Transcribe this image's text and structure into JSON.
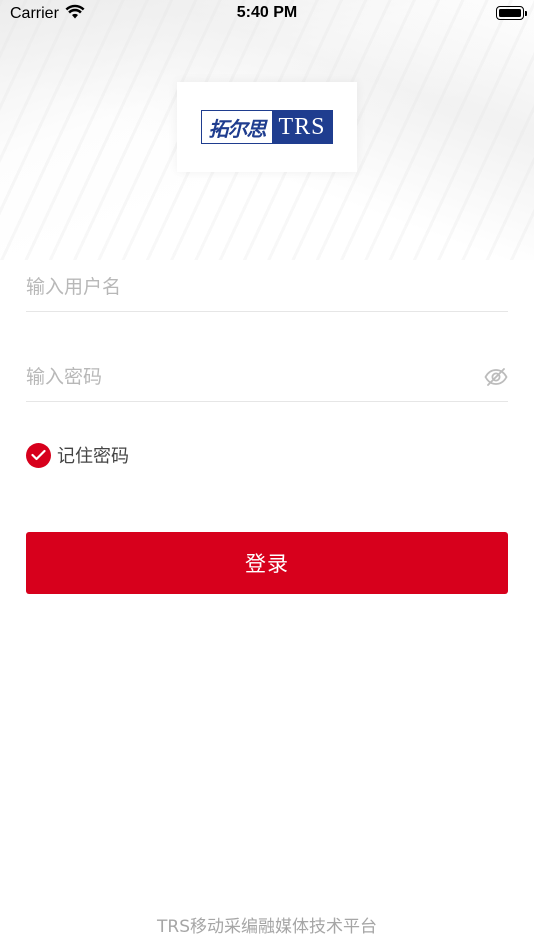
{
  "status_bar": {
    "carrier": "Carrier",
    "time": "5:40 PM"
  },
  "logo": {
    "chinese_text": "拓尔思",
    "english_text": "TRS"
  },
  "form": {
    "username_placeholder": "输入用户名",
    "username_value": "",
    "password_placeholder": "输入密码",
    "password_value": "",
    "remember_label": "记住密码",
    "remember_checked": true,
    "login_label": "登录"
  },
  "footer": {
    "text": "TRS移动采编融媒体技术平台"
  },
  "colors": {
    "accent": "#d7001c",
    "logo_blue": "#1f3d8f",
    "placeholder": "#b8b8b8",
    "footer": "#a6a6a6"
  },
  "icons": {
    "wifi": "wifi-icon",
    "battery": "battery-icon",
    "password_toggle": "eye-slash-icon",
    "remember_check": "checkmark-icon"
  }
}
